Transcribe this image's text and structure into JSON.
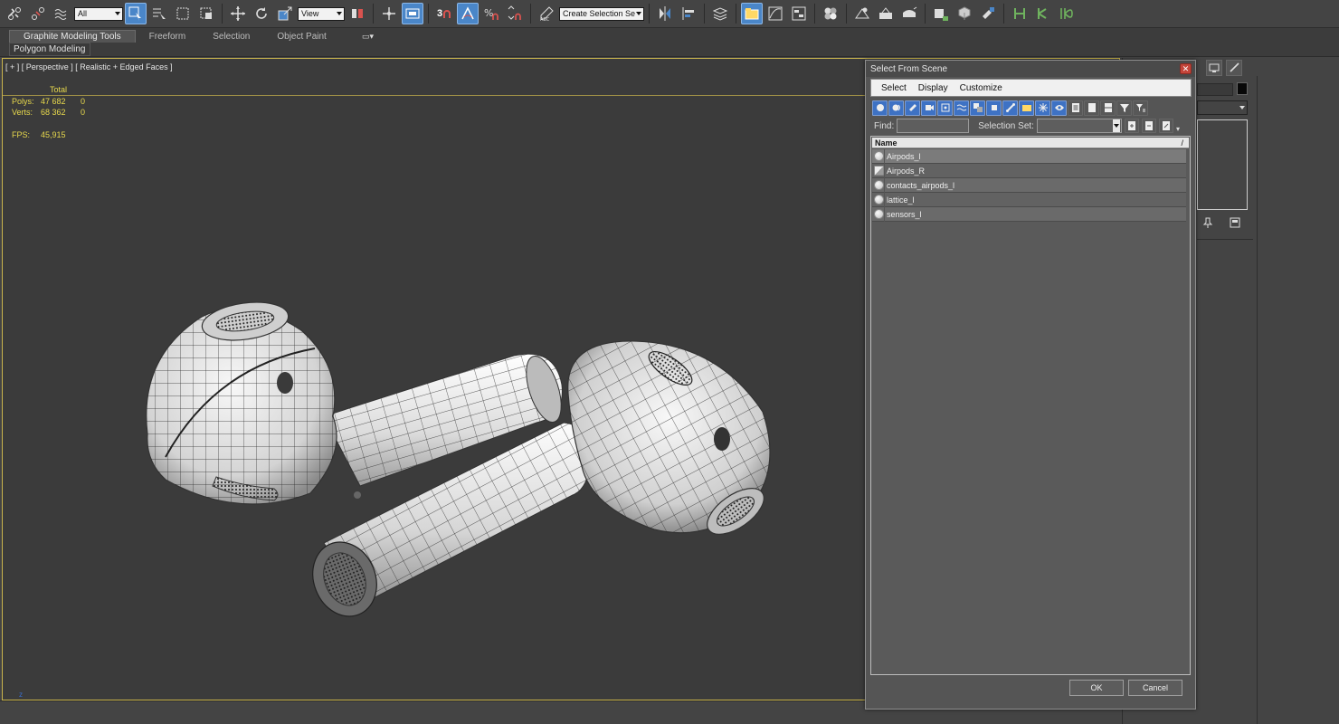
{
  "toolbar": {
    "filter_dropdown": "All",
    "ref_coord_dropdown": "View",
    "snap_number": "3",
    "named_selection": "Create Selection Se"
  },
  "ribbon": {
    "tabs": [
      "Graphite Modeling Tools",
      "Freeform",
      "Selection",
      "Object Paint"
    ],
    "active_tab": 0,
    "panel_label": "Polygon Modeling"
  },
  "viewport": {
    "label": "[ + ] [ Perspective ] [ Realistic + Edged Faces ]",
    "stats": {
      "header": "Total",
      "polys_label": "Polys:",
      "polys_value": "47 682",
      "polys_sel": "0",
      "verts_label": "Verts:",
      "verts_value": "68 362",
      "verts_sel": "0",
      "fps_label": "FPS:",
      "fps_value": "45,915"
    },
    "axis_label": "z"
  },
  "dialog": {
    "title": "Select From Scene",
    "menu": [
      "Select",
      "Display",
      "Customize"
    ],
    "find_label": "Find:",
    "selection_set_label": "Selection Set:",
    "list_header": "Name",
    "items": [
      {
        "name": "Airpods_l",
        "type": "object",
        "selected": true
      },
      {
        "name": "Airpods_R",
        "type": "group",
        "selected": false
      },
      {
        "name": "contacts_airpods_l",
        "type": "object",
        "selected": false
      },
      {
        "name": "lattice_l",
        "type": "object",
        "selected": false
      },
      {
        "name": "sensors_l",
        "type": "object",
        "selected": false
      }
    ],
    "ok_label": "OK",
    "cancel_label": "Cancel"
  },
  "colors": {
    "viewport_border": "#c9b44c",
    "stats_text": "#e8d94c",
    "active_tool": "#4a86c8"
  }
}
